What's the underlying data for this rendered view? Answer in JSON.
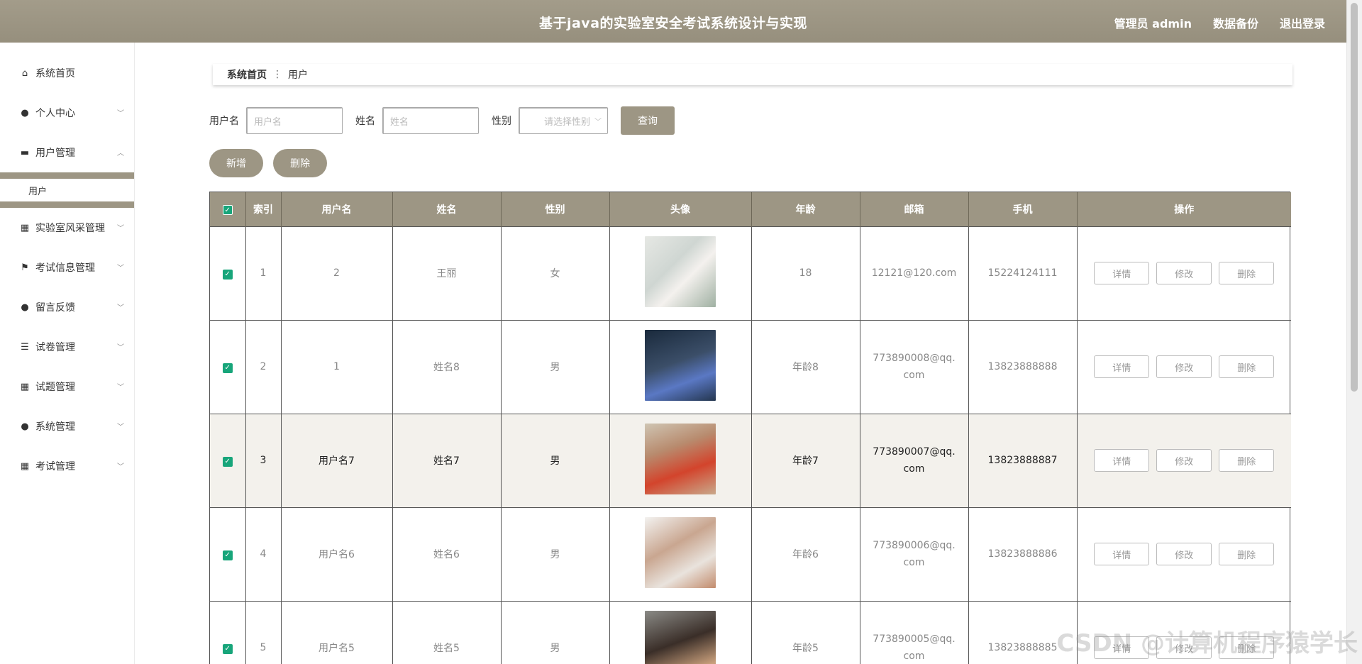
{
  "header": {
    "title": "基于java的实验室安全考试系统设计与实现",
    "user": "管理员 admin",
    "backup": "数据备份",
    "logout": "退出登录"
  },
  "sidebar": {
    "items": [
      {
        "label": "系统首页",
        "icon": "home-icon",
        "glyph": "⌂"
      },
      {
        "label": "个人中心",
        "icon": "user-icon",
        "glyph": "●"
      },
      {
        "label": "用户管理",
        "icon": "monitor-icon",
        "glyph": "▬"
      },
      {
        "label": "实验室风采管理",
        "icon": "grid-icon",
        "glyph": "▦"
      },
      {
        "label": "考试信息管理",
        "icon": "flag-icon",
        "glyph": "⚑"
      },
      {
        "label": "留言反馈",
        "icon": "bulb-icon",
        "glyph": "●"
      },
      {
        "label": "试卷管理",
        "icon": "list-icon",
        "glyph": "☰"
      },
      {
        "label": "试题管理",
        "icon": "grid-icon",
        "glyph": "▦"
      },
      {
        "label": "系统管理",
        "icon": "user-icon",
        "glyph": "●"
      },
      {
        "label": "考试管理",
        "icon": "grid-icon",
        "glyph": "▦"
      }
    ],
    "submenu_user": "用户"
  },
  "breadcrumb": {
    "home": "系统首页",
    "sep": "⋮",
    "current": "用户"
  },
  "filters": {
    "username_label": "用户名",
    "username_placeholder": "用户名",
    "name_label": "姓名",
    "name_placeholder": "姓名",
    "gender_label": "性别",
    "gender_placeholder": "请选择性别",
    "query_button": "查询"
  },
  "actions": {
    "add": "新增",
    "delete": "删除"
  },
  "table": {
    "headers": [
      "索引",
      "用户名",
      "姓名",
      "性别",
      "头像",
      "年龄",
      "邮箱",
      "手机",
      "操作"
    ],
    "rows": [
      {
        "index": "1",
        "username": "2",
        "name": "王丽",
        "gender": "女",
        "age": "18",
        "email": "12121@120.com",
        "phone": "15224124111"
      },
      {
        "index": "2",
        "username": "1",
        "name": "姓名8",
        "gender": "男",
        "age": "年龄8",
        "email": "773890008@qq.com",
        "phone": "13823888888"
      },
      {
        "index": "3",
        "username": "用户名7",
        "name": "姓名7",
        "gender": "男",
        "age": "年龄7",
        "email": "773890007@qq.com",
        "phone": "13823888887"
      },
      {
        "index": "4",
        "username": "用户名6",
        "name": "姓名6",
        "gender": "男",
        "age": "年龄6",
        "email": "773890006@qq.com",
        "phone": "13823888886"
      },
      {
        "index": "5",
        "username": "用户名5",
        "name": "姓名5",
        "gender": "男",
        "age": "年龄5",
        "email": "773890005@qq.com",
        "phone": "13823888885"
      }
    ],
    "op_detail": "详情",
    "op_edit": "修改",
    "op_delete": "删除"
  },
  "watermark": "CSDN @计算机程序猿学长",
  "colors": {
    "accent": "#9d9684",
    "checkbox": "#17a57a"
  }
}
